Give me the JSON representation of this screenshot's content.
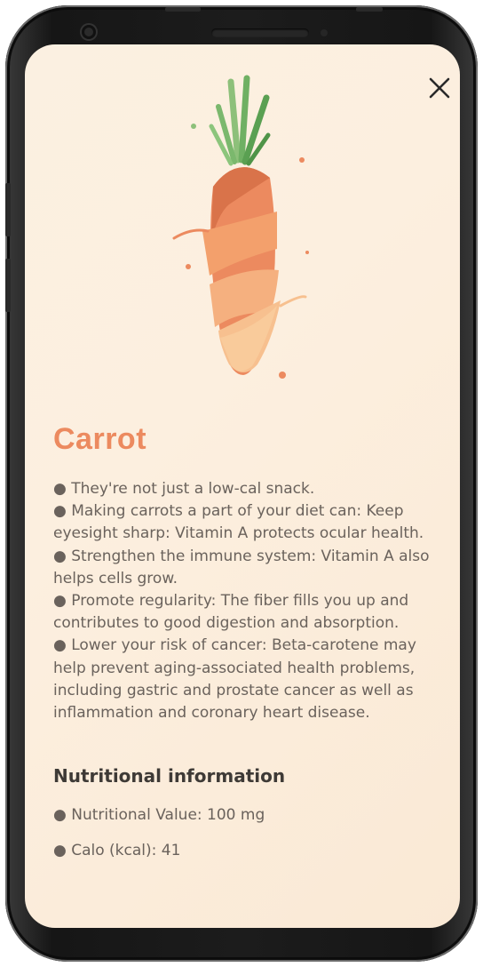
{
  "header": {
    "close_icon": "close-icon"
  },
  "illustration": {
    "icon": "carrot-illustration"
  },
  "food": {
    "name": "Carrot",
    "description_lines": [
      "● They're not just a low-cal snack.",
      "● Making carrots a part of your diet can: Keep eyesight sharp: Vitamin A protects ocular health.",
      "● Strengthen the immune system: Vitamin A also helps cells grow.",
      "● Promote regularity: The fiber fills you up and contributes to good digestion and absorption.",
      "● Lower your risk of cancer: Beta-carotene may help prevent aging-associated health problems, including gastric and prostate cancer as well as inflammation and coronary heart disease."
    ]
  },
  "nutrition": {
    "title": "Nutritional information",
    "items": [
      "● Nutritional Value: 100 mg",
      "● Calo (kcal): 41"
    ]
  },
  "colors": {
    "accent": "#ec8a5f",
    "background": "#fbf0e1",
    "text": "#6a625c",
    "heading": "#3e3a36"
  }
}
